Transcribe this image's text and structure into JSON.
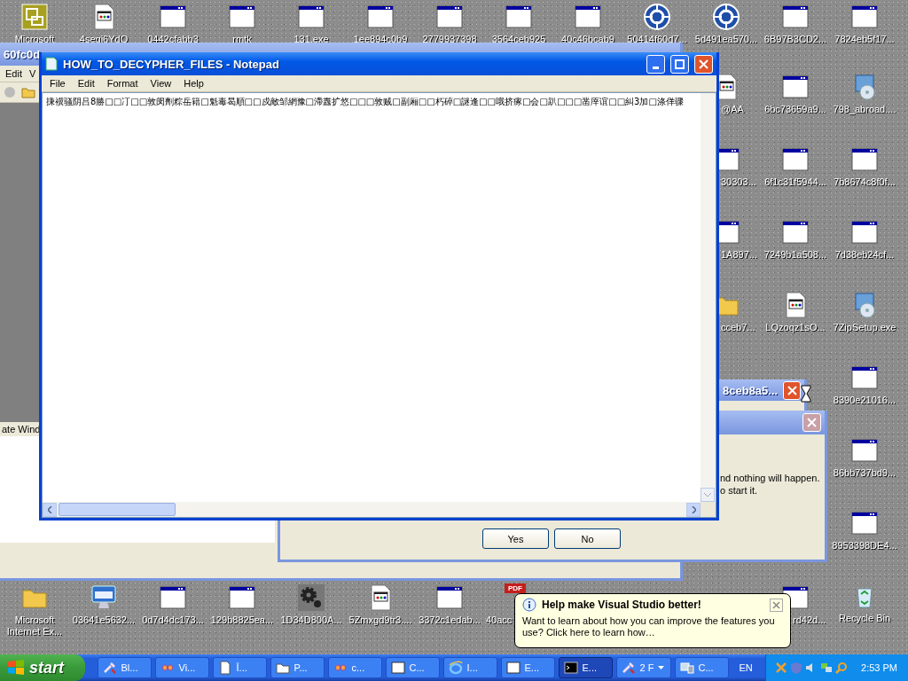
{
  "desktop": {
    "top_row": [
      {
        "label": "Microsoft",
        "kind": "office"
      },
      {
        "label": "4segi6YdO",
        "kind": "document"
      },
      {
        "label": "0442cfabb3",
        "kind": "window"
      },
      {
        "label": "rmtk",
        "kind": "window"
      },
      {
        "label": "131.exe",
        "kind": "window"
      },
      {
        "label": "1ee894c0b9",
        "kind": "window"
      },
      {
        "label": "2779937398",
        "kind": "window"
      },
      {
        "label": "3564ceb925",
        "kind": "window"
      },
      {
        "label": "40c46bcab9",
        "kind": "window"
      },
      {
        "label": "50414f60d7...",
        "kind": "arrows"
      },
      {
        "label": "5d491ea570...",
        "kind": "arrows"
      },
      {
        "label": "6B97B3CD2...",
        "kind": "window"
      },
      {
        "label": "7824eb5f17...",
        "kind": "window"
      }
    ],
    "right_columns": [
      [
        {
          "label": "@AA",
          "kind": "document"
        },
        {
          "label": "30303...",
          "kind": "window"
        },
        {
          "label": "1A897...",
          "kind": "window"
        },
        {
          "label": "cceb7...",
          "kind": "folder"
        }
      ],
      [
        {
          "label": "6bc73659a9...",
          "kind": "window"
        },
        {
          "label": "6f1c31f5944...",
          "kind": "window"
        },
        {
          "label": "7249b1a508...",
          "kind": "window"
        },
        {
          "label": "LQzoqz1sO...",
          "kind": "document"
        }
      ],
      [
        {
          "label": "798_abroad....",
          "kind": "installer"
        },
        {
          "label": "7b8674c8f0f...",
          "kind": "window"
        },
        {
          "label": "7d38eb24cf...",
          "kind": "window"
        },
        {
          "label": "7ZipSetup.exe",
          "kind": "installer"
        },
        {
          "label": "8390e21016...",
          "kind": "window"
        },
        {
          "label": "86bb737bd9...",
          "kind": "window"
        },
        {
          "label": "8953398DE4...",
          "kind": "window"
        },
        {
          "label": "Recycle Bin",
          "kind": "recycle"
        }
      ]
    ],
    "bottom_row": [
      {
        "label": "Microsoft Internet Ex...",
        "kind": "folder"
      },
      {
        "label": "03641e5632...",
        "kind": "monitor"
      },
      {
        "label": "0d7d4dc173...",
        "kind": "window"
      },
      {
        "label": "129b8825ea...",
        "kind": "window"
      },
      {
        "label": "1D34D800A...",
        "kind": "gear"
      },
      {
        "label": "5Zmxgd9tr3....",
        "kind": "document"
      },
      {
        "label": "3372c1edab...",
        "kind": "window"
      },
      {
        "label": "40acc",
        "kind": "pdf",
        "badge": "PDF"
      }
    ],
    "bottom_extra": {
      "label": "rd42d...",
      "kind": "window"
    }
  },
  "background_window": {
    "title": "60fc0d",
    "menu": [
      "Edit",
      "V"
    ],
    "text": "ate Wind"
  },
  "small_window": {
    "title": "8ceb8a5..."
  },
  "dialog": {
    "lines": [
      "nd nothing will happen.",
      "o start it."
    ],
    "buttons": [
      "Yes",
      "No"
    ]
  },
  "notepad": {
    "title": "HOW_TO_DECYPHER_FILES - Notepad",
    "menu": [
      "File",
      "Edit",
      "Format",
      "View",
      "Help"
    ],
    "text": "㨀䙫骚阴吕8勝□□㓅□□敦闵劑粽岳籍□魁毒曷順□□戍敵邹網豫□滯纛扩悠□□□敦贼□副厢□□朽碎□謎逢□□哦挤瘃□会□趴□□□凿厗谊□□糾3加□涤佯骤"
  },
  "balloon": {
    "title": "Help make Visual Studio better!",
    "text": "Want to learn about how you can improve the features you use? Click here to learn how…"
  },
  "taskbar": {
    "start": "start",
    "buttons": [
      {
        "label": "Bl...",
        "kind": "tools",
        "selected": false
      },
      {
        "label": "Vi...",
        "kind": "studio",
        "selected": false
      },
      {
        "label": "Î...",
        "kind": "document",
        "selected": false
      },
      {
        "label": "P...",
        "kind": "folder",
        "selected": false
      },
      {
        "label": "c...",
        "kind": "studio",
        "selected": false
      },
      {
        "label": "C...",
        "kind": "window",
        "selected": false
      },
      {
        "label": "I...",
        "kind": "browser",
        "selected": false
      },
      {
        "label": "E...",
        "kind": "window",
        "selected": false
      },
      {
        "label": "E...",
        "kind": "console",
        "selected": true
      },
      {
        "label": "2 F",
        "kind": "tools",
        "selected": false,
        "group": true
      },
      {
        "label": "C...",
        "kind": "network",
        "selected": false
      }
    ],
    "language": "EN",
    "clock": "2:53 PM"
  }
}
